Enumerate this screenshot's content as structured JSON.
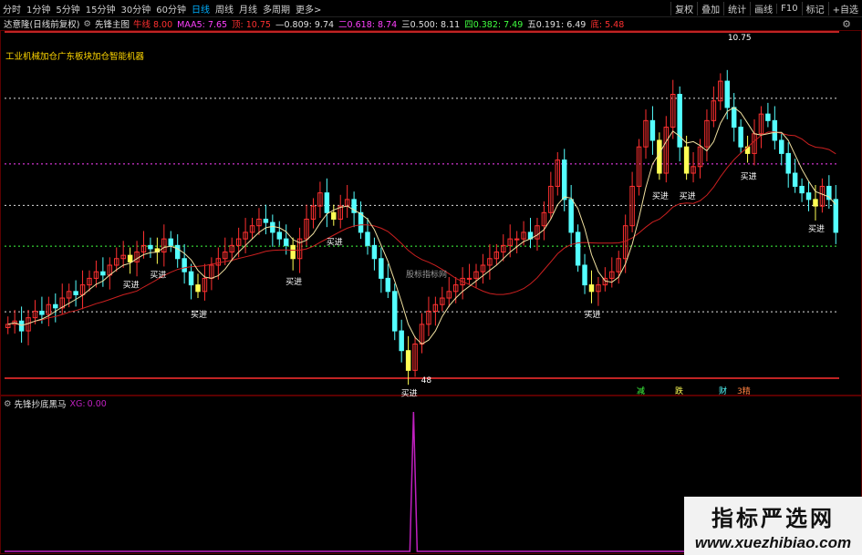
{
  "toolbar": {
    "periods": [
      "分时",
      "1分钟",
      "5分钟",
      "15分钟",
      "30分钟",
      "60分钟",
      "日线",
      "周线",
      "月线",
      "多周期",
      "更多>"
    ],
    "active_period": "日线",
    "tools": [
      "复权",
      "叠加",
      "统计",
      "画线",
      "F10",
      "标记",
      "+自选"
    ]
  },
  "info": {
    "stock_name": "达意隆(日线前复权)",
    "indicator_name": "先锋主图",
    "items": [
      {
        "label": "牛线",
        "value": "8.00",
        "color": "#ff3030"
      },
      {
        "label": "MAA5:",
        "value": "7.65",
        "color": "#ff40ff"
      },
      {
        "label": "顶:",
        "value": "10.75",
        "color": "#ff3030"
      },
      {
        "label": "—0.809:",
        "value": "9.74",
        "color": "#e0e0e0"
      },
      {
        "label": "二0.618:",
        "value": "8.74",
        "color": "#ff40ff"
      },
      {
        "label": "三0.500:",
        "value": "8.11",
        "color": "#e0e0e0"
      },
      {
        "label": "四0.382:",
        "value": "7.49",
        "color": "#40ff40"
      },
      {
        "label": "五0.191:",
        "value": "6.49",
        "color": "#e0e0e0"
      },
      {
        "label": "底:",
        "value": "5.48",
        "color": "#ff3030"
      }
    ]
  },
  "caption": "工业机械加仓广东板块加仓智能机器",
  "labels": {
    "high_price": "10.75",
    "low_price": "48",
    "buy": "买进",
    "watermark_center": "股标指标网",
    "bottom_signals": [
      "减",
      "跌",
      "财",
      "3精"
    ]
  },
  "sub": {
    "name": "先锋抄底黑马",
    "xg_label": "XG:",
    "xg_value": "0.00"
  },
  "watermark": {
    "line1": "指标严选网",
    "line2": "www.xuezhibiao.com"
  },
  "colors": {
    "up": "#ff3030",
    "down": "#54ffff",
    "buy": "#ffff54",
    "ma": "#ff40ff",
    "signal": "#c020c0",
    "bg": "#000000"
  },
  "chart_data": {
    "type": "candlestick",
    "fib_levels": [
      {
        "name": "顶",
        "value": 10.75
      },
      {
        "name": "一",
        "value": 9.74
      },
      {
        "name": "二",
        "value": 8.74
      },
      {
        "name": "三",
        "value": 8.11
      },
      {
        "name": "四",
        "value": 7.49
      },
      {
        "name": "五",
        "value": 6.49
      },
      {
        "name": "底",
        "value": 5.48
      }
    ],
    "close_series": [
      6.3,
      6.35,
      6.2,
      6.4,
      6.5,
      6.45,
      6.6,
      6.55,
      6.7,
      6.8,
      6.75,
      6.9,
      7.0,
      7.1,
      7.05,
      7.2,
      7.3,
      7.35,
      7.25,
      7.4,
      7.5,
      7.45,
      7.4,
      7.6,
      7.5,
      7.3,
      7.1,
      6.9,
      6.8,
      7.0,
      7.2,
      7.3,
      7.4,
      7.5,
      7.6,
      7.7,
      7.8,
      7.9,
      7.85,
      7.7,
      7.6,
      7.5,
      7.3,
      7.6,
      7.9,
      8.1,
      8.3,
      8.0,
      7.9,
      8.1,
      8.2,
      8.0,
      7.7,
      7.5,
      7.3,
      7.0,
      6.8,
      6.2,
      5.9,
      5.6,
      6.0,
      6.3,
      6.5,
      6.6,
      6.7,
      6.8,
      6.9,
      7.0,
      7.0,
      7.1,
      7.2,
      7.3,
      7.4,
      7.5,
      7.6,
      7.6,
      7.7,
      7.6,
      7.8,
      8.0,
      8.4,
      8.8,
      8.2,
      7.7,
      7.2,
      6.9,
      6.8,
      6.9,
      7.0,
      7.1,
      7.3,
      7.8,
      8.4,
      9.0,
      9.4,
      9.1,
      8.6,
      9.3,
      9.8,
      9.0,
      8.6,
      8.7,
      9.0,
      9.4,
      9.7,
      10.0,
      9.6,
      9.3,
      9.0,
      8.9,
      9.2,
      9.5,
      9.4,
      9.1,
      8.9,
      8.6,
      8.4,
      8.3,
      8.2,
      8.1,
      8.4,
      8.2,
      7.7
    ],
    "signal_series": {
      "name": "XG",
      "spike_index_fraction": 0.49,
      "value": 1
    }
  }
}
